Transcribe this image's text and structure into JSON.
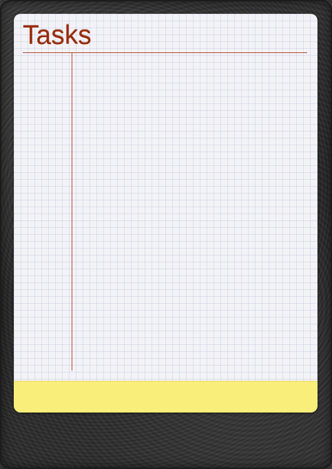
{
  "app": {
    "title": "Tasks"
  },
  "task_list": {
    "items": []
  },
  "input_bar": {
    "placeholder": "",
    "value": ""
  },
  "colors": {
    "title": "#9a2a08",
    "rule": "#b04a35",
    "paper": "#f3f3f7",
    "input_bar": "#f8ee79",
    "leather": "#2f2f2f"
  }
}
